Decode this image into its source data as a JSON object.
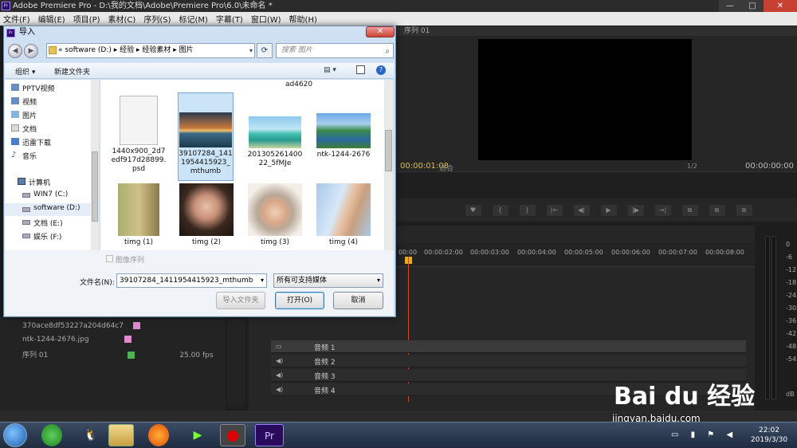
{
  "window": {
    "title": "Adobe Premiere Pro - D:\\我的文档\\Adobe\\Premiere Pro\\6.0\\未命名 *",
    "app_badge": "Pr",
    "controls": [
      "—",
      "□",
      "✕"
    ]
  },
  "menu": [
    "文件(F)",
    "编辑(E)",
    "项目(P)",
    "素材(C)",
    "序列(S)",
    "标记(M)",
    "字幕(T)",
    "窗口(W)",
    "帮助(H)"
  ],
  "monitor": {
    "tab": "序列 01",
    "timecode_left": "00:00:01:08",
    "fit": "适合",
    "fraction": "1/2",
    "timecode_right": "00:00:00:00",
    "controls": [
      "♥",
      "{",
      "}",
      "|←",
      "◀|",
      "▶",
      "|▶",
      "→|",
      "⧉",
      "⧉",
      "⧉",
      "⧉"
    ]
  },
  "timeline": {
    "ticks": [
      "00:00",
      "00:00:02:00",
      "00:00:03:00",
      "00:00:04:00",
      "00:00:05:00",
      "00:00:06:00",
      "00:00:07:00",
      "00:00:08:00"
    ],
    "tracks": [
      "音频 1",
      "音频 2",
      "音频 3",
      "音频 4"
    ]
  },
  "project": {
    "items": [
      {
        "name": "370ace8df53227a204d64c7",
        "color": "#e08ad0",
        "extra": ""
      },
      {
        "name": "ntk-1244-2676.jpg",
        "color": "#e08ad0",
        "extra": ""
      },
      {
        "name": "序列 01",
        "color": "#4fb04f",
        "extra": "25.00 fps"
      }
    ]
  },
  "meter": {
    "labels": [
      "0",
      "-6",
      "-12",
      "-18",
      "-24",
      "-30",
      "-36",
      "-42",
      "-48",
      "-54",
      "dB"
    ]
  },
  "dialog": {
    "title": "导入",
    "address": {
      "prefix": "«",
      "path": [
        "software (D:)",
        "经验",
        "经验素材",
        "图片"
      ]
    },
    "search_placeholder": "搜索 图片",
    "toolbar": {
      "organize": "组织 ▾",
      "new_folder": "新建文件夹"
    },
    "nav_items": [
      {
        "label": "PPTV视频",
        "icon": "video-folder-icon"
      },
      {
        "label": "视频",
        "icon": "video-folder-icon"
      },
      {
        "label": "图片",
        "icon": "picture-folder-icon"
      },
      {
        "label": "文档",
        "icon": "document-folder-icon"
      },
      {
        "label": "迅雷下载",
        "icon": "download-folder-icon"
      },
      {
        "label": "音乐",
        "icon": "music-folder-icon"
      },
      {
        "label": "计算机",
        "icon": "computer-icon"
      },
      {
        "label": "WIN7 (C:)",
        "icon": "drive-icon"
      },
      {
        "label": "software (D:)",
        "icon": "drive-icon"
      },
      {
        "label": "文档 (E:)",
        "icon": "drive-icon"
      },
      {
        "label": "娱乐 (F:)",
        "icon": "drive-icon"
      }
    ],
    "top_partial_label": "ad4620",
    "files": [
      {
        "name": "1440x900_2d7edf917d28899.psd",
        "thumb": "blank"
      },
      {
        "name": "39107284_1411954415923_mthumb",
        "thumb": "sunset"
      },
      {
        "name": "20130526140022_5fMJe",
        "thumb": "island"
      },
      {
        "name": "ntk-1244-2676",
        "thumb": "lake"
      },
      {
        "name": "timg (1)",
        "thumb": "girl1"
      },
      {
        "name": "timg (2)",
        "thumb": "girl2"
      },
      {
        "name": "timg (3)",
        "thumb": "girl3"
      },
      {
        "name": "timg (4)",
        "thumb": "girl4"
      }
    ],
    "image_sequence_label": "图像序列",
    "filename_label": "文件名(N):",
    "filename_value": "39107284_1411954415923_mthumb",
    "filter_value": "所有可支持媒体",
    "btn_import_folder": "导入文件夹",
    "btn_open": "打开(O)",
    "btn_cancel": "取消"
  },
  "taskbar": {
    "time": "22:02",
    "date": "2019/3/30",
    "pr_badge": "Pr"
  },
  "watermark": {
    "logo": "Bai du 经验",
    "url": "jingyan.baidu.com"
  }
}
